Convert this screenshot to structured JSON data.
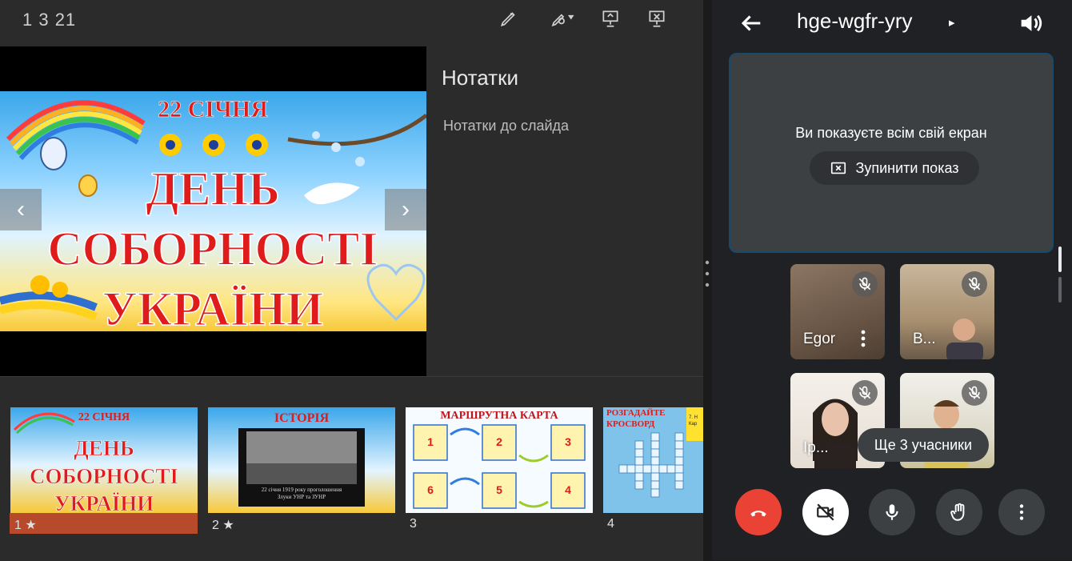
{
  "slides_app": {
    "slide_counter": "1 3 21",
    "toolbar": {
      "pen_icon": "pen-icon",
      "laser_icon": "laser-pointer-icon",
      "present_icon": "presentation-icon",
      "stop_present_icon": "stop-presentation-icon"
    },
    "current_slide": {
      "date_line": "22 СІЧНЯ",
      "title_line1": "ДЕНЬ",
      "title_line2": "СОБОРНОСТІ",
      "title_line3": "УКРАЇНИ"
    },
    "notes": {
      "title": "Нотатки",
      "text": "Нотатки до слайда"
    },
    "thumbnails": [
      {
        "number": "1 ★",
        "title_a": "22 СІЧНЯ",
        "title_b": "ДЕНЬ",
        "title_c": "СОБОРНОСТІ",
        "title_d": "УКРАЇНИ"
      },
      {
        "number": "2 ★",
        "title_a": "ІСТОРІЯ",
        "caption_a": "22 січня 1919 року проголошення",
        "caption_b": "Злуки УНР та ЗУНР"
      },
      {
        "number": "3",
        "title_a": "МАРШРУТНА КАРТА",
        "nums": [
          "1",
          "2",
          "3",
          "6",
          "5",
          "4"
        ]
      },
      {
        "number": "4",
        "title_a": "РОЗГАДАЙТЕ",
        "title_b": "КРОСВОРД",
        "side_a": "7. Н",
        "side_b": "Кар"
      }
    ]
  },
  "meet": {
    "meeting_code": "hge-wgfr-yry",
    "code_caret": "▸",
    "share_message": "Ви показуєте всім свій екран",
    "stop_share_label": "Зупинити показ",
    "participants": [
      {
        "name": "Egor"
      },
      {
        "name": "В..."
      },
      {
        "name": "Ір..."
      },
      {
        "name": ""
      }
    ],
    "more_participants": "Ще 3 учасники",
    "controls": [
      "end-call",
      "camera-off",
      "microphone",
      "raise-hand",
      "more-options"
    ],
    "colors": {
      "end_call": "#ea4335",
      "camera_off_bg": "#ffffff",
      "panel": "#202124"
    }
  }
}
